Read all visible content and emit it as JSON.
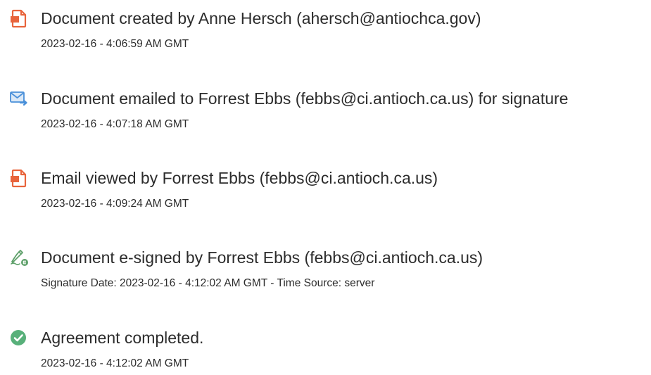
{
  "events": [
    {
      "icon": "pdf-document-icon",
      "title": "Document created by Anne Hersch (ahersch@antiochca.gov)",
      "meta": "2023-02-16 - 4:06:59 AM GMT"
    },
    {
      "icon": "email-sent-icon",
      "title": "Document emailed to Forrest Ebbs (febbs@ci.antioch.ca.us) for signature",
      "meta": "2023-02-16 - 4:07:18 AM GMT"
    },
    {
      "icon": "pdf-document-icon",
      "title": "Email viewed by Forrest Ebbs (febbs@ci.antioch.ca.us)",
      "meta": "2023-02-16 - 4:09:24 AM GMT"
    },
    {
      "icon": "e-sign-pen-icon",
      "title": "Document e-signed by Forrest Ebbs (febbs@ci.antioch.ca.us)",
      "meta": "Signature Date: 2023-02-16 - 4:12:02 AM GMT - Time Source: server"
    },
    {
      "icon": "check-circle-icon",
      "title": "Agreement completed.",
      "meta": "2023-02-16 - 4:12:02 AM GMT"
    }
  ],
  "colors": {
    "pdf_icon": "#e8643c",
    "email_icon": "#4a90d9",
    "esign_icon": "#5ea06a",
    "check_icon": "#58b07a",
    "text": "#2c2c2c"
  }
}
